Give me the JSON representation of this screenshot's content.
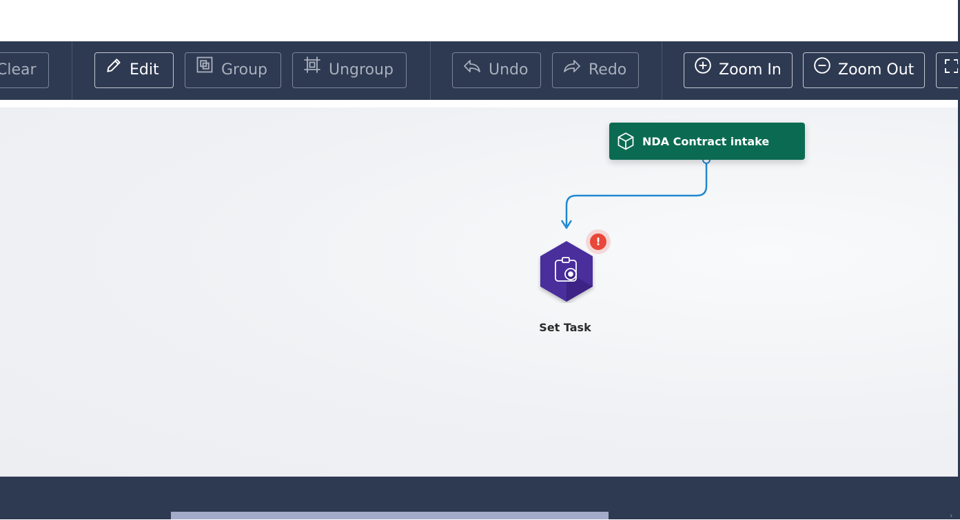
{
  "toolbar": {
    "clear_label": "Clear",
    "edit_label": "Edit",
    "group_label": "Group",
    "ungroup_label": "Ungroup",
    "undo_label": "Undo",
    "redo_label": "Redo",
    "zoom_in_label": "Zoom In",
    "zoom_out_label": "Zoom Out"
  },
  "workflow": {
    "start_node": {
      "label": "NDA Contract intake",
      "icon": "cube-icon"
    },
    "task_node": {
      "label": "Set Task",
      "icon": "task-gear-icon",
      "alert": "!"
    }
  },
  "colors": {
    "toolbar_bg": "#2e3a52",
    "start_node_bg": "#0b6b52",
    "task_node_bg": "#4a2d9c",
    "connector": "#1e88d0",
    "alert": "#e8483a"
  }
}
